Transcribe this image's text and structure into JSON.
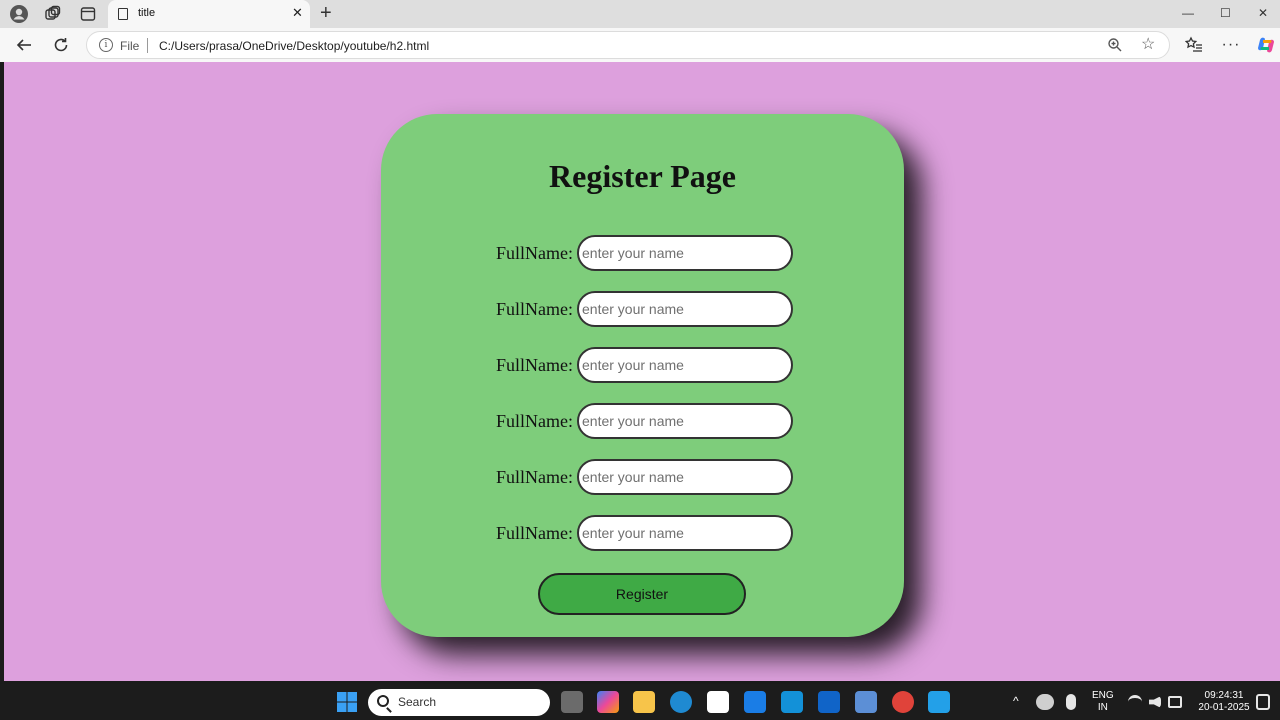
{
  "browser": {
    "tab_title": "title",
    "tab_close": "✕",
    "new_tab": "+",
    "address_scheme": "File",
    "address_url": "C:/Users/prasa/OneDrive/Desktop/youtube/h2.html",
    "window_controls": {
      "minimize": "—",
      "maximize": "☐",
      "close": "✕"
    }
  },
  "page": {
    "background_color": "#dda0dd",
    "card_color": "#7ecd7b",
    "heading": "Register Page",
    "fields": [
      {
        "label": "FullName:",
        "placeholder": "enter your name"
      },
      {
        "label": "FullName:",
        "placeholder": "enter your name"
      },
      {
        "label": "FullName:",
        "placeholder": "enter your name"
      },
      {
        "label": "FullName:",
        "placeholder": "enter your name"
      },
      {
        "label": "FullName:",
        "placeholder": "enter your name"
      },
      {
        "label": "FullName:",
        "placeholder": "enter your name"
      }
    ],
    "submit_label": "Register",
    "button_color": "#3faa45"
  },
  "taskbar": {
    "search_label": "Search",
    "language": "ENG",
    "region": "IN",
    "time": "09:24:31",
    "date": "20-01-2025"
  }
}
